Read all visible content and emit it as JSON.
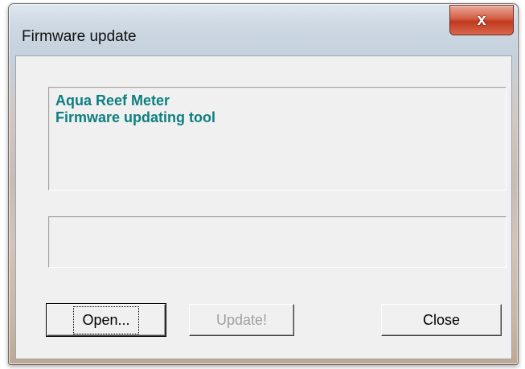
{
  "window": {
    "title": "Firmware update",
    "close_glyph": "x"
  },
  "info": {
    "line1": "Aqua Reef Meter",
    "line2": "Firmware updating tool",
    "text_color": "#0d7f80"
  },
  "status": {
    "text": ""
  },
  "buttons": {
    "open_label": "Open...",
    "update_label": "Update!",
    "update_enabled": false,
    "close_label": "Close"
  },
  "colors": {
    "close_button": "#c8432a",
    "client_background": "#f0f0f0"
  }
}
